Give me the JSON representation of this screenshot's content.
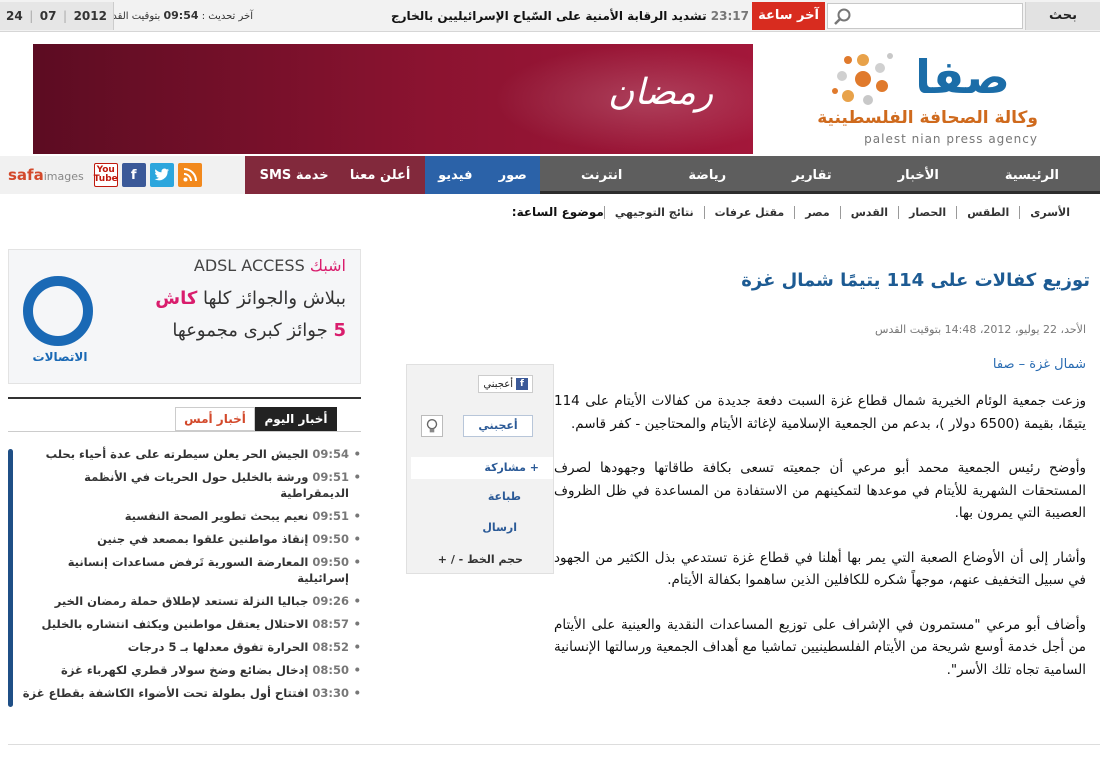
{
  "topbar": {
    "search_label": "بحث",
    "breaking_label": "آخر ساعة",
    "breaking_time": "23:17",
    "breaking_text": "تشديد الرقابة الأمنية على السّياح الإسرائيليين بالخارج",
    "update_label": "آخر تحديث :",
    "update_time": "09:54",
    "update_suffix": "بتوقيت القدس",
    "date_year": "2012",
    "date_month": "07",
    "date_day": "24"
  },
  "header": {
    "banner_text": "رمضان",
    "logo_word": "صفا",
    "logo_subtitle_ar": "وكالة الصحافة الفلسطينية",
    "logo_subtitle_en": "palest nian press agency",
    "accent_color": "#d82c1f",
    "brand_color": "#1b6da8"
  },
  "nav": {
    "main": [
      "الرئيسية",
      "الأخبار",
      "تقارير",
      "رياضة",
      "انترنت"
    ],
    "media": [
      "صور",
      "فيديو"
    ],
    "sms": [
      "أعلن معنا",
      "خدمة SMS"
    ],
    "safa_images": "safa",
    "safa_images_suffix": "images",
    "social_icons": [
      "youtube-icon",
      "facebook-icon",
      "twitter-icon",
      "rss-icon"
    ],
    "youtube_label_top": "You",
    "youtube_label_bottom": "Tube"
  },
  "topics": {
    "label": "موضوع الساعة:",
    "items": [
      "نتائج التوجيهي",
      "مقتل عرفات",
      "مصر",
      "القدس",
      "الحصار",
      "الطقس",
      "الأسرى"
    ]
  },
  "article": {
    "title": "توزيع كفالات على 114 يتيمًا شمال غزة",
    "date": "الأحد، 22 يوليو، 2012، 14:48 بتوقيت القدس",
    "source": "شمال غزة – صفا",
    "paragraphs": [
      "وزعت جمعية الوئام الخيرية شمال قطاع غزة السبت دفعة جديدة من كفالات الأيتام على 114 يتيمًا، بقيمة (6500 دولار )، بدعم من الجمعية الإسلامية لإغاثة الأيتام والمحتاجين - كفر قاسم.",
      "وأوضح رئيس الجمعية محمد أبو مرعي أن جمعيته تسعى بكافة طاقاتها وجهودها لصرف المستحقات الشهرية للأيتام في موعدها لتمكينهم من الاستفادة من المساعدة في ظل الظروف العصيبة التي يمرون بها.",
      "وأشار إلى أن الأوضاع الصعبة التي يمر بها أهلنا في قطاع غزة تستدعي بذل الكثير من الجهود في سبيل التخفيف عنهم، موجهاً شكره للكافلين الذين ساهموا بكفالة الأيتام.",
      "وأضاف أبو مرعي \"مستمرون في الإشراف على توزيع المساعدات النقدية والعينية على الأيتام من أجل خدمة أوسع شريحة من الأيتام الفلسطينيين تماشيا مع أهداف الجمعية ورسالتها الإنسانية السامية تجاه تلك الأسر\"."
    ]
  },
  "share": {
    "fb_like": "أعجبني",
    "like_button": "أعجبني",
    "more": "+ مشاركة",
    "print": "طباعة",
    "send": "ارسال",
    "font_size": "حجم الخط - / +"
  },
  "ad": {
    "line1_pink": "اشبك",
    "line1_rest": "ADSL ACCESS",
    "line2_pink": "كاش",
    "line2_rest": "ببلاش والجوائز كلها",
    "line3_pink": "5",
    "line3_rest": "جوائز كبرى مجموعها",
    "logo_text": "الاتصالات"
  },
  "news": {
    "tab_today": "أخبار اليوم",
    "tab_yesterday": "أخبار أمس",
    "items": [
      {
        "time": "09:54",
        "text": "الجيش الحر يعلن سيطرته على عدة أحياء بحلب"
      },
      {
        "time": "09:51",
        "text": "ورشة بالخليل حول الحريات في الأنظمة الديمقراطية"
      },
      {
        "time": "09:51",
        "text": "نعيم يبحث تطوير الصحة النفسية"
      },
      {
        "time": "09:50",
        "text": "إنقاذ مواطنين علقوا بمصعد في جنين"
      },
      {
        "time": "09:50",
        "text": "المعارضة السورية تَرفض مساعدات إنسانية إسرائيلية"
      },
      {
        "time": "09:26",
        "text": "جباليا النزلة تستعد لإطلاق حملة رمضان الخير"
      },
      {
        "time": "08:57",
        "text": "الاحتلال يعتقل مواطنين ويكثف انتشاره بالخليل"
      },
      {
        "time": "08:52",
        "text": "الحرارة تفوق معدلها بـ 5 درجات"
      },
      {
        "time": "08:50",
        "text": "إدخال بضائع وضخ سولار قطري لكهرباء غزة"
      },
      {
        "time": "03:30",
        "text": "افتتاح أول بطولة تحت الأضواء الكاشفة بقطاع غزة"
      }
    ]
  }
}
